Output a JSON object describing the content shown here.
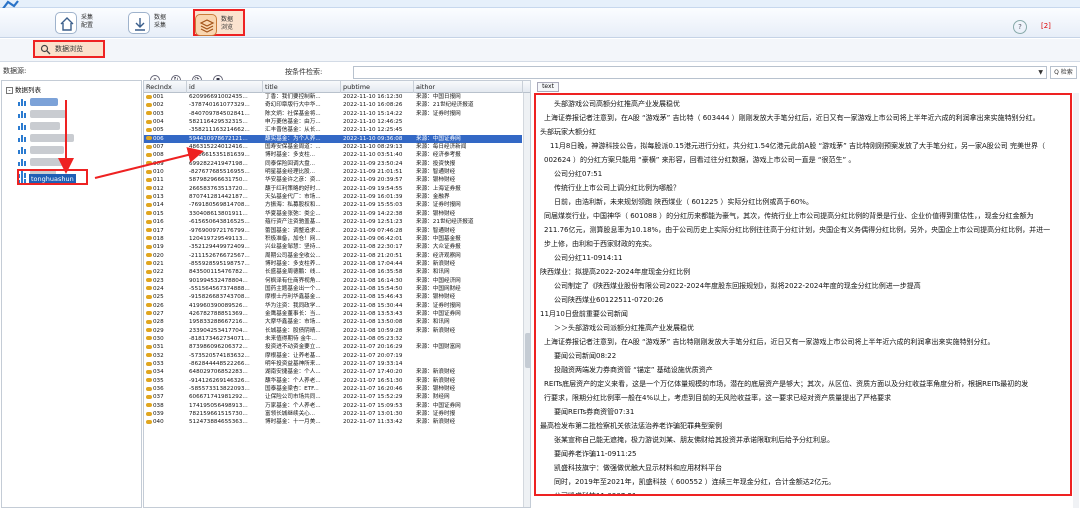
{
  "toolbar": {
    "buttons": [
      {
        "label": "采集\n配置",
        "icon": "home-icon"
      },
      {
        "label": "数据\n采集",
        "icon": "download-icon"
      },
      {
        "label": "数据\n浏览",
        "icon": "layers-icon",
        "active": true
      }
    ],
    "right_note": "[2]"
  },
  "tab": {
    "label": "数据浏览"
  },
  "source_label": "数据源:",
  "tree": {
    "root_label": "数据列表",
    "selected_label": "tonghuashun"
  },
  "filter": {
    "label": "按条件检索:",
    "search_label": "Q 检索"
  },
  "table": {
    "columns": [
      "RecIndx",
      "id",
      "title",
      "pubtime",
      "aithor"
    ],
    "rows": [
      [
        "001",
        "620996691002435...",
        "丁香：我们要控制新...",
        "2022-11-10 16:12:30",
        "来源：中国日报网"
      ],
      [
        "002",
        "-378740161077329...",
        "奇幻印章版行大中华...",
        "2022-11-10 16:08:26",
        "来源：21世纪经济报道"
      ],
      [
        "003",
        "-840709784502841...",
        "陈文炳：社保基金将...",
        "2022-11-10 15:14:22",
        "来源：证券时报网"
      ],
      [
        "004",
        "582116429532315...",
        "申万菱信基金：由万...",
        "2022-11-10 12:46:25",
        ""
      ],
      [
        "005",
        "-358211163214662...",
        "汇丰晋信基金：从长...",
        "2022-11-10 12:25:45",
        ""
      ],
      [
        "006",
        "594410978672121...",
        "蘸实基金：为个人养...",
        "2022-11-10 09:36:08",
        "来源：中国证券网"
      ],
      [
        "007",
        "486315224012416...",
        "国寿安保基金周道：...",
        "2022-11-10 08:29:13",
        "来源：每日经济新闻"
      ],
      [
        "008",
        "-410661535181639...",
        "博时基金：多支柱...",
        "2022-11-10 03:51:40",
        "来源：经济参考报"
      ],
      [
        "009",
        "699282241947198...",
        "同泰保险回调大盘...",
        "2022-11-09 23:50:24",
        "来源：投资快报"
      ],
      [
        "010",
        "-827677685516955...",
        "明星基金经理比股...",
        "2022-11-09 21:01:51",
        "来源：智通财经"
      ],
      [
        "011",
        "587982966631750...",
        "华安基金许之彦：资...",
        "2022-11-09 20:39:57",
        "来源：银柿财经"
      ],
      [
        "012",
        "266583763513720...",
        "蘸于红利策略的好时...",
        "2022-11-09 19:54:55",
        "来源：上海证券报"
      ],
      [
        "013",
        "870741281442187...",
        "天弘基金代厂：市场...",
        "2022-11-09 16:01:39",
        "来源：金融界"
      ],
      [
        "014",
        "-769180569814708...",
        "方振海：私募股权和...",
        "2022-11-09 15:55:03",
        "来源：证券时报网"
      ],
      [
        "015",
        "330408613801911...",
        "华夏基金张弛：类企...",
        "2022-11-09 14:22:38",
        "来源：银柿财经"
      ],
      [
        "016",
        "-615650643816525...",
        "蕴行资产注资驰盖基...",
        "2022-11-09 12:51:23",
        "来源：21世纪经济报道"
      ],
      [
        "017",
        "-976900972176799...",
        "蕾国基金：调整追求...",
        "2022-11-09 07:46:28",
        "来源：智通财经"
      ],
      [
        "018",
        "120419729549113...",
        "积极准备，加仓！网...",
        "2022-11-09 06:42:01",
        "来源：中国基金报"
      ],
      [
        "019",
        "-352129449972409...",
        "兴业基金邹慧：坚持...",
        "2022-11-08 22:30:17",
        "来源：大众证券报"
      ],
      [
        "020",
        "-211152676672567...",
        "周期公司基金全收公...",
        "2022-11-08 21:20:51",
        "来源：经济观察网"
      ],
      [
        "021",
        "-855928595198757...",
        "博时基金：多支柱养...",
        "2022-11-08 17:04:44",
        "来源：新浪财经"
      ],
      [
        "022",
        "843500115476782...",
        "长盛基金周德鹏：线...",
        "2022-11-08 16:35:58",
        "来源：和讯网"
      ],
      [
        "023",
        "901994532478804...",
        "何枫泽有仕商界视角...",
        "2022-11-08 16:14:30",
        "来源：中国经济网"
      ],
      [
        "024",
        "-551564567374888...",
        "国药主题基金出一个...",
        "2022-11-08 15:54:50",
        "来源：中国网财经"
      ],
      [
        "025",
        "-915826683743708...",
        "摩根士丹利华鑫基金...",
        "2022-11-08 15:46:43",
        "来源：银柿财经"
      ],
      [
        "026",
        "419960390089526...",
        "华为注资：我同政学...",
        "2022-11-08 15:30:44",
        "来源：证券时报网"
      ],
      [
        "027",
        "426782788851369...",
        "金鹰基金董事长：当...",
        "2022-11-08 13:53:43",
        "来源：中国证券网"
      ],
      [
        "028",
        "195833288667216...",
        "大摩华鑫基金：市场...",
        "2022-11-08 13:50:08",
        "来源：和讯网"
      ],
      [
        "029",
        "233904253417704...",
        "长城基金：股债阴晴...",
        "2022-11-08 10:59:28",
        "来源：新浪财经"
      ],
      [
        "030",
        "-818173462734071...",
        "未来值得期待 金牛...",
        "2022-11-08 05:23:32",
        ""
      ],
      [
        "031",
        "873986096206372...",
        "投资进不动资金要立...",
        "2022-11-07 20:16:29",
        "来源：中国财富网"
      ],
      [
        "032",
        "-573520574183632...",
        "摩根基金：让养老基...",
        "2022-11-07 20:07:19",
        ""
      ],
      [
        "033",
        "-862844448522266...",
        "明年投资益基神所来...",
        "2022-11-07 19:33:14",
        ""
      ],
      [
        "034",
        "648029706852283...",
        "湖南安捷基金：个人...",
        "2022-11-07 17:40:20",
        "来源：新浪财经"
      ],
      [
        "035",
        "-914126269146326...",
        "蘸华基金：个人养老...",
        "2022-11-07 16:51:30",
        "来源：新浪财经"
      ],
      [
        "036",
        "-585573313822093...",
        "国泰基金梁杏：ETF...",
        "2022-11-07 16:20:46",
        "来源：银柿财经"
      ],
      [
        "037",
        "606671741981292...",
        "让保险公司市场共同...",
        "2022-11-07 15:52:29",
        "来源：财经网"
      ],
      [
        "038",
        "174195056498913...",
        "万家基金：个人养老...",
        "2022-11-07 15:09:53",
        "来源：中国证券网"
      ],
      [
        "039",
        "782159661515730...",
        "富领长城继续关心...",
        "2022-11-07 13:01:30",
        "来源：证券时报"
      ],
      [
        "040",
        "512473884655363...",
        "博时基金：十一月美...",
        "2022-11-07 11:33:42",
        "来源：新浪财经"
      ]
    ]
  },
  "document": {
    "tab_label": "text",
    "lines": [
      "头部游戏公司高额分红推高产业发展稳优",
      "上海证券报记者注意到，在A股 “游戏茅” 吉比特（ 603444 ）刚刚发放大手笔分红后，近日又有一家游戏上市公司将上半年近六成的利润拿出来实施特别分红。",
      "头部玩家大额分红",
      "11月8日晚，神游科技公告，拟每股派0.15港元进行分红，共分红1.54亿港元此前A股 “游戏茅” 吉比特刚刚预案发放了大手笔分红，另一家A股公司 完美世界（",
      "002624 ）的分红方案只能用 “豪横” 来形容，回看过往分红数据，游戏上市公司一直是 “很范生” 。",
      "公司分红07:51",
      "传统行业上市公司上调分红比例为哪般？",
      "日前，由浩利新，未来规划领跑 陕西煤业（ 601225 ）实际分红比例或高于60%。",
      "同届煤炭行业，中国神华（ 601088 ）的分红历来都能为豪气，其次，传统行业上市公司提高分红比例的背景是行业、企业价值得到重估性，，现金分红金额为",
      "211.76亿元，测算股息率为10.18%，由于公司历史上实际分红比例往往高于分红计划，央国企有义务偶得分红比例，另外，央国企上市公司提高分红比例，并进一",
      "步上修，由利和于西家财政的充实。",
      "公司分红11-0914:11",
      "陕西煤业：拟提高2022-2024年度现金分红比例",
      "公司制定了《陕西煤业股份有限公司2022-2024年度股东回报规划》，拟将2022-2024年度的现金分红比例进一步提高",
      "公司陕西煤业60122511-0720:26",
      "11月10日盘前重要公司新闻",
      "＞＞头部游戏公司派额分红推高产业发展稳优",
      "上海证券报记者注意到，在A股 “游戏茅” 吉比特刚刚发放大手笔分红后，近日又有一家游戏上市公司将上半年近六成的利润拿出来实施特别分红。",
      "要闻公司新闻08:22",
      "投融资两端发力券商资管 “锚定” 基础设施优质资产",
      "REITs底层资产的定义来看，这是一个万亿体量规模的市场，潜在的底层资产是够大；其次，从区位、资质方面以及分红收益率角度分析，根据REITs最初的发",
      "行要求，限期分红比例率一般在4%以上，考虑到目前的无风险收益率，这一要求已经对资产质量提出了严格要求",
      "要闻REITs券商资管07:31",
      "最高检发布第二批检察机关依法惩治养老诈骗犯罪典型案例",
      "张某宣称自己能无遮掩，极力游说刘某、朋友佛财给其投资并承诺限取利后给予分红利息。",
      "要闻养老诈骗11-0911:25",
      "凯盛科技旗宁：做强做优触大显示材料和应用材料平台",
      "同时，2019年至2021年，凯盛科技（ 600552 ）连续三年现金分红，合计金额达2亿元。",
      "公司凯盛科技11-0907:51"
    ]
  },
  "colors": {
    "highlight_red": "#e22",
    "selection_blue": "#3368c5"
  }
}
